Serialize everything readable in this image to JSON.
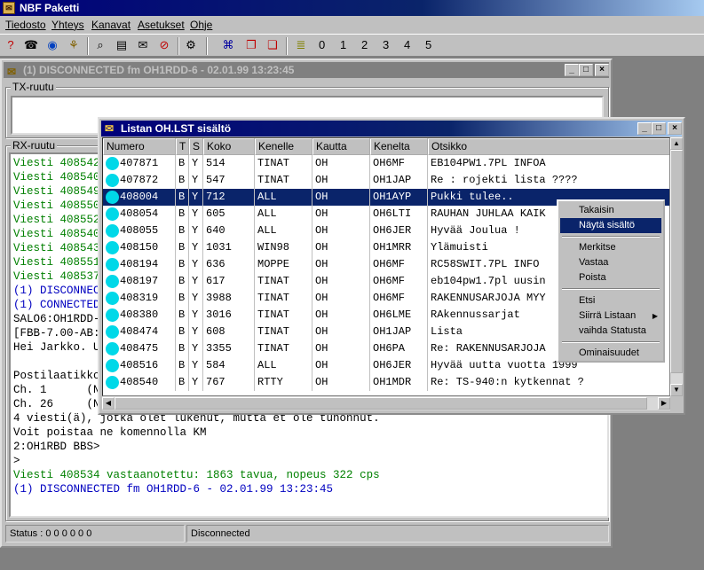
{
  "app": {
    "title": "NBF Paketti"
  },
  "menu": [
    "Tiedosto",
    "Yhteys",
    "Kanavat",
    "Asetukset",
    "Ohje"
  ],
  "toolbar": {
    "channels": [
      "0",
      "1",
      "2",
      "3",
      "4",
      "5"
    ]
  },
  "conn_window": {
    "title": "(1) DISCONNECTED fm OH1RDD-6 - 02.01.99 13:23:45",
    "tx_label": "TX-ruutu",
    "rx_label": "RX-ruutu",
    "rx_lines": [
      {
        "text": "Viesti 408542",
        "color": "#008000"
      },
      {
        "text": "Viesti 408540",
        "color": "#008000"
      },
      {
        "text": "Viesti 408549",
        "color": "#008000"
      },
      {
        "text": "Viesti 408550",
        "color": "#008000"
      },
      {
        "text": "Viesti 408552",
        "color": "#008000"
      },
      {
        "text": "Viesti 408540",
        "color": "#008000"
      },
      {
        "text": "Viesti 408543",
        "color": "#008000"
      },
      {
        "text": "Viesti 408551",
        "color": "#008000"
      },
      {
        "text": "Viesti 408537",
        "color": "#008000"
      },
      {
        "text": "(1) DISCONNECT",
        "color": "#0000c0"
      },
      {
        "text": "(1) CONNECTED",
        "color": "#0000c0"
      },
      {
        "text": "SALO6:OH1RDD-",
        "color": "#000000"
      },
      {
        "text": "[FBB-7.00-AB:",
        "color": "#000000"
      },
      {
        "text": "Hei Jarkko. U",
        "color": "#000000"
      },
      {
        "text": "",
        "color": "#000000"
      },
      {
        "text": "Postilaatikko",
        "color": "#000000"
      },
      {
        "text": "Ch. 1      (NC",
        "color": "#000000"
      },
      {
        "text": "Ch. 26     (NC",
        "color": "#000000"
      },
      {
        "text": "4 viesti(ä), jotka olet lukenut, mutta et ole tuhonnut.",
        "color": "#000000"
      },
      {
        "text": "Voit poistaa ne komennolla KM",
        "color": "#000000"
      },
      {
        "text": "2:OH1RBD BBS>",
        "color": "#000000"
      },
      {
        "text": ">",
        "color": "#000000"
      },
      {
        "text": "Viesti 408534 vastaanotettu: 1863 tavua, nopeus 322 cps",
        "color": "#008000"
      },
      {
        "text": "(1) DISCONNECTED fm OH1RDD-6 - 02.01.99 13:23:45",
        "color": "#0000c0"
      }
    ],
    "status_left": "Status : 0 0 0 0 0 0",
    "status_right": "Disconnected"
  },
  "list_window": {
    "title": "Listan OH.LST sisältö",
    "columns": [
      "Numero",
      "T",
      "S",
      "Koko",
      "Kenelle",
      "Kautta",
      "Kenelta",
      "Otsikko"
    ],
    "rows": [
      [
        "407871",
        "B",
        "Y",
        "514",
        "TINAT",
        "OH",
        "OH6MF",
        "EB104PW1.7PL  INFOA"
      ],
      [
        "407872",
        "B",
        "Y",
        "547",
        "TINAT",
        "OH",
        "OH1JAP",
        "Re : rojekti lista ????"
      ],
      [
        "408004",
        "B",
        "Y",
        "712",
        "ALL",
        "OH",
        "OH1AYP",
        "Pukki tulee.."
      ],
      [
        "408054",
        "B",
        "Y",
        "605",
        "ALL",
        "OH",
        "OH6LTI",
        "RAUHAN JUHLAA KAIK"
      ],
      [
        "408055",
        "B",
        "Y",
        "640",
        "ALL",
        "OH",
        "OH6JER",
        "Hyvää Joulua !"
      ],
      [
        "408150",
        "B",
        "Y",
        "1031",
        "WIN98",
        "OH",
        "OH1MRR",
        "Ylämuisti"
      ],
      [
        "408194",
        "B",
        "Y",
        "636",
        "MOPPE",
        "OH",
        "OH6MF",
        "RC58SWIT.7PL  INFO"
      ],
      [
        "408197",
        "B",
        "Y",
        "617",
        "TINAT",
        "OH",
        "OH6MF",
        "eb104pw1.7pl uusin"
      ],
      [
        "408319",
        "B",
        "Y",
        "3988",
        "TINAT",
        "OH",
        "OH6MF",
        "RAKENNUSARJOJA MYY"
      ],
      [
        "408380",
        "B",
        "Y",
        "3016",
        "TINAT",
        "OH",
        "OH6LME",
        "RAkennussarjat"
      ],
      [
        "408474",
        "B",
        "Y",
        "608",
        "TINAT",
        "OH",
        "OH1JAP",
        "Lista"
      ],
      [
        "408475",
        "B",
        "Y",
        "3355",
        "TINAT",
        "OH",
        "OH6PA",
        "Re: RAKENNUSARJOJA"
      ],
      [
        "408516",
        "B",
        "Y",
        "584",
        "ALL",
        "OH",
        "OH6JER",
        "Hyvää uutta vuotta 1999"
      ],
      [
        "408540",
        "B",
        "Y",
        "767",
        "RTTY",
        "OH",
        "OH1MDR",
        "Re: TS-940:n kytkennat ?"
      ]
    ],
    "selected_row": 2
  },
  "context_menu": {
    "items": [
      "Takaisin",
      "Näytä sisältö",
      "Merkitse",
      "Vastaa",
      "Poista",
      "Etsi",
      "Siirrä Listaan",
      "vaihda Statusta",
      "Ominaisuudet"
    ],
    "highlighted": 1
  }
}
